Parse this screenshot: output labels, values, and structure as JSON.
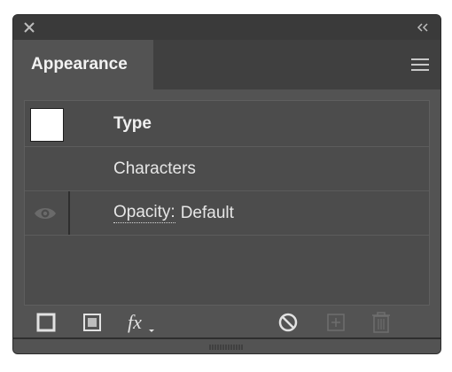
{
  "panel": {
    "tab_label": "Appearance"
  },
  "rows": {
    "type_label": "Type",
    "characters_label": "Characters",
    "opacity_label": "Opacity:",
    "opacity_value": "Default"
  },
  "colors": {
    "panel_bg": "#535353",
    "titlebar_bg": "#3a3a3a",
    "swatch_fill": "#ffffff"
  },
  "icons": {
    "close": "close-icon",
    "collapse": "collapse-chevrons-icon",
    "menu": "hamburger-menu-icon",
    "visibility": "eye-icon",
    "add_stroke": "add-new-stroke-icon",
    "add_fill": "add-new-fill-icon",
    "effects": "fx-icon",
    "clear": "clear-appearance-icon",
    "duplicate": "duplicate-item-icon",
    "delete": "trash-icon"
  }
}
